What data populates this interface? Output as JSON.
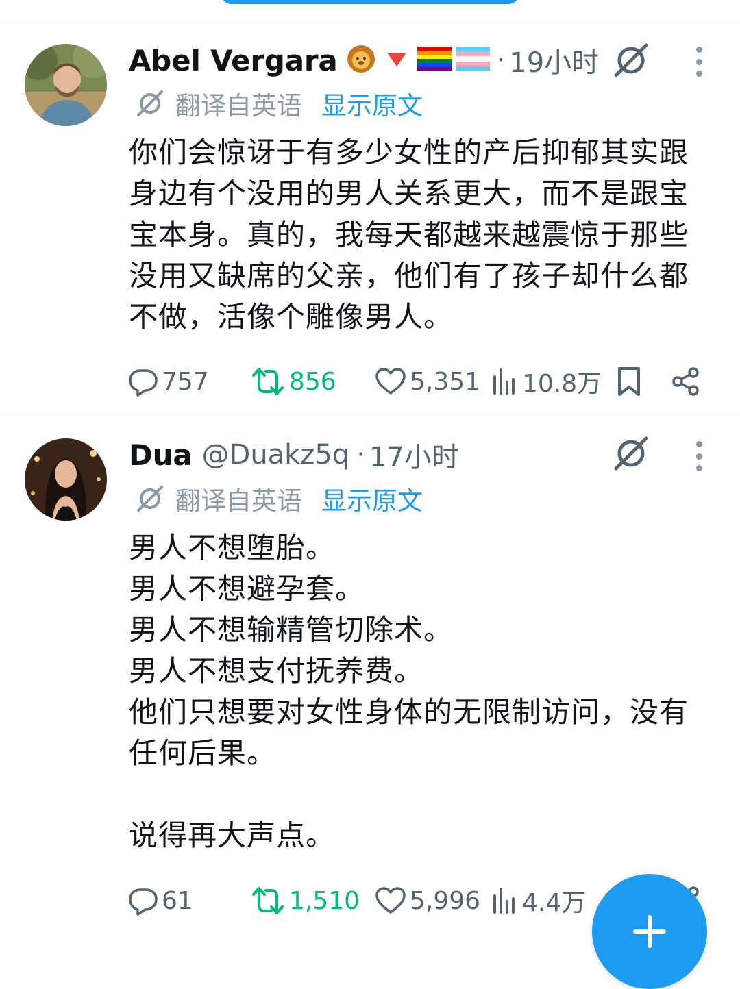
{
  "tweets": [
    {
      "name": "Abel Vergara",
      "handle": "",
      "name_emojis": [
        "lion-emoji",
        "red-triangle-emoji",
        "rainbow-flag-emoji",
        "transgender-flag-emoji"
      ],
      "separator": "·",
      "time": "19小时",
      "translated_label": "翻译自英语",
      "show_original": "显示原文",
      "text": "你们会惊讶于有多少女性的产后抑郁其实跟\n身边有个没用的男人关系更大，而不是跟宝\n宝本身。真的，我每天都越来越震惊于那些\n没用又缺席的父亲，他们有了孩子却什么都\n不做，活像个雕像男人。",
      "replies": "757",
      "retweets": "856",
      "likes": "5,351",
      "views": "10.8万"
    },
    {
      "name": "Dua",
      "handle": "@Duakz5q",
      "separator": "·",
      "time": "17小时",
      "translated_label": "翻译自英语",
      "show_original": "显示原文",
      "text": "男人不想堕胎。\n男人不想避孕套。\n男人不想输精管切除术。\n男人不想支付抚养费。\n他们只想要对女性身体的无限制访问，没有\n任何后果。\n\n说得再大声点。",
      "replies": "61",
      "retweets": "1,510",
      "likes": "5,996",
      "views": "4.4万"
    }
  ],
  "colors": {
    "accent": "#1d9bf0",
    "retweet": "#00ba7c",
    "secondary_text": "#536471",
    "primary_text": "#0f1419"
  }
}
